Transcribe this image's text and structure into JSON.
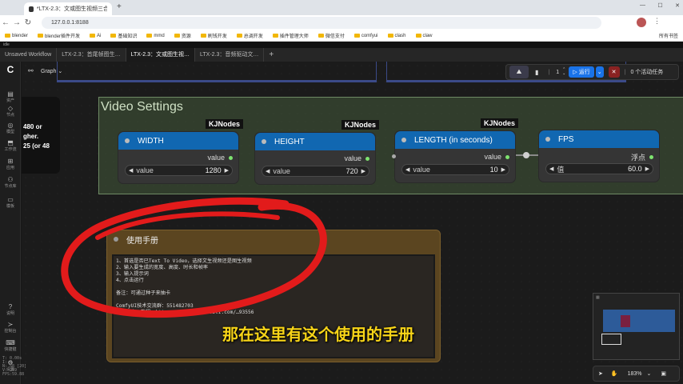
{
  "browser": {
    "tab_title": "*LTX-2.3：文或图生视频三合一…",
    "new_tab": "+",
    "url": "127.0.0.1:8188",
    "window_controls": [
      "—",
      "☐",
      "✕"
    ],
    "nav": [
      "←",
      "→",
      "↻"
    ],
    "bookmarks": [
      "blender",
      "blender插件开发",
      "Ai",
      "基础知识",
      "mmd",
      "资源",
      "刷钱开发",
      "总调开发",
      "插件管理大师",
      "微信支付",
      "comfyui",
      "clash",
      "claw"
    ],
    "bookmarks_right": "所有书签"
  },
  "app": {
    "title": "idle",
    "tabs": [
      "Unsaved Workflow",
      "LTX-2.3：首尾帧图生…",
      "LTX-2.3：文或图生视…",
      "LTX-2.3：音频驱动文…"
    ],
    "add_tab": "+",
    "graph_label": "Graph"
  },
  "sidebar": [
    {
      "icon": "C",
      "label": ""
    },
    {
      "icon": "▤",
      "label": "资产"
    },
    {
      "icon": "◇",
      "label": "节点"
    },
    {
      "icon": "◎",
      "label": "模型"
    },
    {
      "icon": "⬒",
      "label": "工作流"
    },
    {
      "icon": "⊞",
      "label": "应用"
    },
    {
      "icon": "⚇",
      "label": "节点库"
    },
    {
      "icon": "▭",
      "label": "模板"
    },
    {
      "icon": "?",
      "label": "说明"
    },
    {
      "icon": "≻",
      "label": "控制台"
    },
    {
      "icon": "⌨",
      "label": "快捷键"
    },
    {
      "icon": "⚙",
      "label": "设置"
    }
  ],
  "stats": [
    "T: 0.00s",
    "I: 0",
    "N: 58 [20]",
    "V: 249",
    "FPS:59.88"
  ],
  "left_node_text": [
    "480 or",
    "gher.",
    "25 (or 48"
  ],
  "toolbar": {
    "queue_count": "1",
    "run_label": "运行",
    "active_tasks": "0 个活动任务",
    "close": "✕"
  },
  "group_title": "Video Settings",
  "nodes": [
    {
      "badge": "KJNodes",
      "title": "WIDTH",
      "output": "value",
      "widget_label": "value",
      "widget_value": "1280"
    },
    {
      "badge": "KJNodes",
      "title": "HEIGHT",
      "output": "value",
      "widget_label": "value",
      "widget_value": "720"
    },
    {
      "badge": "KJNodes",
      "title": "LENGTH (in seconds)",
      "output": "value",
      "widget_label": "value",
      "widget_value": "10"
    },
    {
      "badge": "",
      "title": "FPS",
      "output": "浮点",
      "widget_label": "值",
      "widget_value": "60.0"
    }
  ],
  "note": {
    "title": "使用手册",
    "lines": [
      "1、首选是否已Text To Video，选择文生视频还是图生视频",
      "2、输入要生成的宽度、高度、时长和帧率",
      "3、输入提示词",
      "4、点击运行",
      "",
      "备注：可通过种子来抽卡",
      "",
      "ComfyUI技术交流群：551482703",
      "了解更多，教程：https://space.bilibili.com/…93556"
    ]
  },
  "subtitle": "那在这里有这个使用的手册",
  "zoom": "183%",
  "colors": {
    "node_header": "#1167b1",
    "group_bg": "#4a5a44",
    "note_bg": "#5b4520",
    "annotation": "#e21b1b",
    "subtitle": "#f7d418",
    "run_button": "#1a73e8"
  }
}
